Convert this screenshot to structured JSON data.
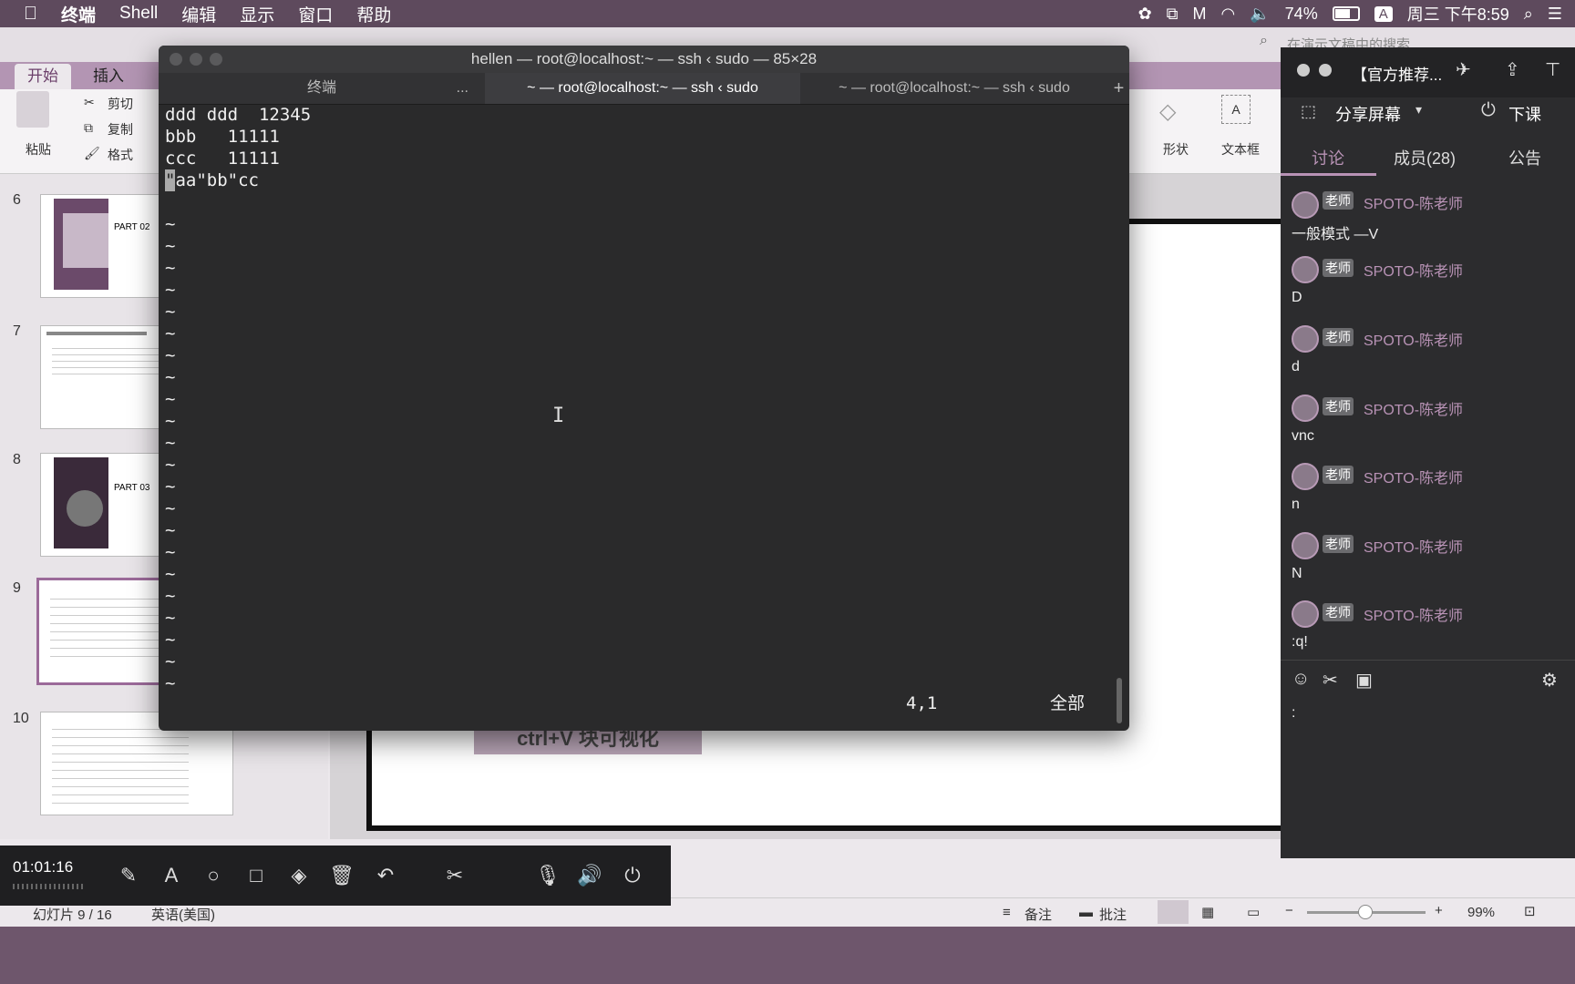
{
  "menubar": {
    "apple_icon": "apple-icon",
    "app_name": "终端",
    "items": [
      "Shell",
      "编辑",
      "显示",
      "窗口",
      "帮助"
    ],
    "battery": "74%",
    "input_method": "A",
    "clock": "周三 下午8:59"
  },
  "ppt": {
    "tabs": [
      "开始",
      "插入"
    ],
    "ribbon": {
      "paste": "粘贴",
      "cut": "剪切",
      "copy": "复制",
      "format": "格式",
      "shape": "形状",
      "textbox": "文本框"
    },
    "search_placeholder": "在演示文稿中的搜索",
    "slides": [
      {
        "num": "6",
        "label": "PART 02"
      },
      {
        "num": "7",
        "label": ""
      },
      {
        "num": "8",
        "label": "PART 03"
      },
      {
        "num": "9",
        "label": ""
      },
      {
        "num": "10",
        "label": ""
      }
    ],
    "slide_caption": "ctrl+V 块可视化",
    "status": {
      "slide_info": "幻灯片 9 / 16",
      "language": "英语(美国)",
      "notes": "备注",
      "comments": "批注",
      "zoom": "99%"
    }
  },
  "terminal": {
    "title": "hellen — root@localhost:~ — ssh ‹ sudo — 85×28",
    "tabs": [
      {
        "label": "终端",
        "more": "..."
      },
      {
        "label": "~ — root@localhost:~ — ssh ‹ sudo"
      },
      {
        "label": "~ — root@localhost:~ — ssh ‹ sudo"
      }
    ],
    "lines": [
      "ddd ddd  12345",
      "bbb   11111",
      "ccc   11111"
    ],
    "cursor_line_cursor": "\"",
    "cursor_line_rest": "aa\"bb\"cc",
    "tilde": "~",
    "position": "4,1",
    "mode": "全部"
  },
  "chat": {
    "title": "【官方推荐...",
    "share_screen": "分享屏幕",
    "end_class": "下课",
    "tabs": [
      "讨论",
      "成员(28)",
      "公告"
    ],
    "badge": "老师",
    "partial_name": "SPOTO-陈老师",
    "partial_text": "一般模式   —V",
    "messages": [
      {
        "name": "SPOTO-陈老师",
        "text": "D"
      },
      {
        "name": "SPOTO-陈老师",
        "text": "d"
      },
      {
        "name": "SPOTO-陈老师",
        "text": "vnc"
      },
      {
        "name": "SPOTO-陈老师",
        "text": "n"
      },
      {
        "name": "SPOTO-陈老师",
        "text": "N"
      },
      {
        "name": "SPOTO-陈老师",
        "text": ":q!"
      }
    ],
    "input_text": ":"
  },
  "meeting_toolbar": {
    "timer": "01:01:16"
  }
}
